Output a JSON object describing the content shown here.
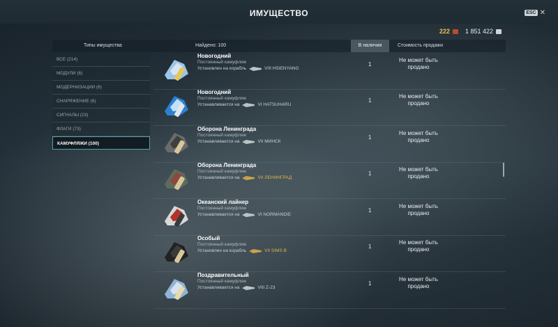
{
  "window": {
    "title": "ИМУЩЕСТВО",
    "esc_label": "ESC",
    "close_glyph": "✕"
  },
  "currency": {
    "doubloons": "222",
    "credits": "1 851 422"
  },
  "table_header": {
    "types": "Типы имущества",
    "found": "Найдено: 100",
    "in_stock": "В наличии",
    "sell_price": "Стоимость продажи"
  },
  "sidebar": {
    "items": [
      {
        "label": "ВСЕ (214)"
      },
      {
        "label": "МОДУЛИ (6)"
      },
      {
        "label": "МОДЕРНИЗАЦИИ (6)"
      },
      {
        "label": "СНАРЯЖЕНИЕ (6)"
      },
      {
        "label": "СИГНАЛЫ (23)"
      },
      {
        "label": "ФЛАГИ (73)"
      },
      {
        "label": "КАМУФЛЯЖИ (100)"
      }
    ],
    "active_index": 6
  },
  "rows": [
    {
      "name": "Новогодний",
      "type": "Постоянный камуфляж",
      "install": "Установлен на корабль",
      "ship": "VIII HSIENYANG",
      "gold": false,
      "qty": "1",
      "price": "Не может быть продано",
      "colors": [
        "#9cc4e8",
        "#d8e4f2",
        "#e3c95a"
      ]
    },
    {
      "name": "Новогодний",
      "type": "Постоянный камуфляж",
      "install": "Устанавливается на",
      "ship": "VI HATSUHARU",
      "gold": false,
      "qty": "1",
      "price": "Не может быть продано",
      "colors": [
        "#2e7fd1",
        "#bfe0f7",
        "#e0e6ea"
      ]
    },
    {
      "name": "Оборона Ленинграда",
      "type": "Постоянный камуфляж",
      "install": "Устанавливается на",
      "ship": "VII МИНСК",
      "gold": false,
      "qty": "1",
      "price": "Не может быть продано",
      "colors": [
        "#6b6b6b",
        "#3f3f3f",
        "#d7c79a"
      ]
    },
    {
      "name": "Оборона Ленинграда",
      "type": "Постоянный камуфляж",
      "install": "Устанавливается на",
      "ship": "VII ЛЕНИНГРАД",
      "gold": true,
      "qty": "1",
      "price": "Не может быть продано",
      "colors": [
        "#5f6a5a",
        "#8a4a3e",
        "#d7c79a"
      ]
    },
    {
      "name": "Океанский лайнер",
      "type": "Постоянный камуфляж",
      "install": "Устанавливается на",
      "ship": "VI NORMANDIE",
      "gold": false,
      "qty": "1",
      "price": "Не может быть продано",
      "colors": [
        "#d8d8d8",
        "#b2332a",
        "#3a3a3a"
      ]
    },
    {
      "name": "Особый",
      "type": "Постоянный камуфляж",
      "install": "Установлен на корабль",
      "ship": "VII SIMS B",
      "gold": true,
      "qty": "1",
      "price": "Не может быть продано",
      "colors": [
        "#222222",
        "#3a3a3a",
        "#d7c79a"
      ]
    },
    {
      "name": "Поздравительный",
      "type": "Постоянный камуфляж",
      "install": "Устанавливается на",
      "ship": "VIII Z-23",
      "gold": false,
      "qty": "1",
      "price": "Не может быть продано",
      "colors": [
        "#8fb3d6",
        "#d6e2ee",
        "#e8d9a8"
      ]
    }
  ]
}
